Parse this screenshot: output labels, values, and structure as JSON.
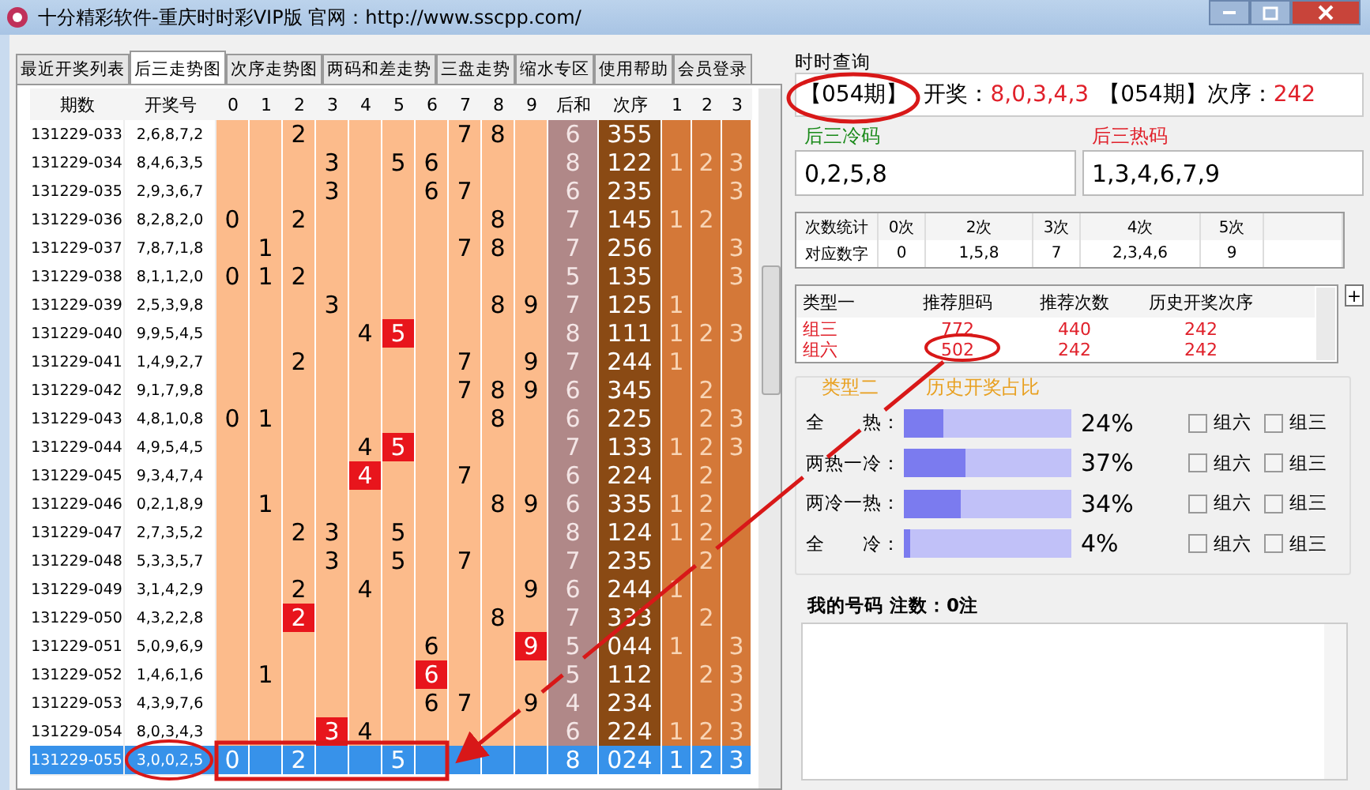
{
  "window": {
    "title": "十分精彩软件-重庆时时彩VIP版 官网：http://www.sscpp.com/"
  },
  "tabs": [
    {
      "label": "最近开奖列表",
      "selected": false
    },
    {
      "label": "后三走势图",
      "selected": true
    },
    {
      "label": "次序走势图",
      "selected": false
    },
    {
      "label": "两码和差走势",
      "selected": false
    },
    {
      "label": "三盘走势",
      "selected": false
    },
    {
      "label": "缩水专区",
      "selected": false
    },
    {
      "label": "使用帮助",
      "selected": false
    },
    {
      "label": "会员登录",
      "selected": false
    }
  ],
  "trend_table": {
    "columns": [
      "期数",
      "开奖号",
      "0",
      "1",
      "2",
      "3",
      "4",
      "5",
      "6",
      "7",
      "8",
      "9",
      "后和",
      "次序",
      "1",
      "2",
      "3"
    ],
    "rows": [
      {
        "period": "131229-033",
        "numbers": "2,6,8,7,2",
        "cells": {
          "d2": {
            "text": "2",
            "red": false
          },
          "d7": {
            "text": "7",
            "red": false
          },
          "d8": {
            "text": "8",
            "red": false
          }
        },
        "sum": "6",
        "order": "355",
        "flags": {},
        "selected": false
      },
      {
        "period": "131229-034",
        "numbers": "8,4,6,3,5",
        "cells": {
          "d3": {
            "text": "3",
            "red": false
          },
          "d5": {
            "text": "5",
            "red": false
          },
          "d6": {
            "text": "6",
            "red": false
          }
        },
        "sum": "8",
        "order": "122",
        "flags": {
          "f1": "1",
          "f2": "2",
          "f3": "3"
        },
        "selected": false
      },
      {
        "period": "131229-035",
        "numbers": "2,9,3,6,7",
        "cells": {
          "d3": {
            "text": "3",
            "red": false
          },
          "d6": {
            "text": "6",
            "red": false
          },
          "d7": {
            "text": "7",
            "red": false
          }
        },
        "sum": "6",
        "order": "235",
        "flags": {
          "f3": "3"
        },
        "selected": false
      },
      {
        "period": "131229-036",
        "numbers": "8,2,8,2,0",
        "cells": {
          "d0": {
            "text": "0",
            "red": false
          },
          "d2": {
            "text": "2",
            "red": false
          },
          "d8": {
            "text": "8",
            "red": false
          }
        },
        "sum": "7",
        "order": "145",
        "flags": {
          "f1": "1",
          "f2": "2"
        },
        "selected": false
      },
      {
        "period": "131229-037",
        "numbers": "7,8,7,1,8",
        "cells": {
          "d1": {
            "text": "1",
            "red": false
          },
          "d7": {
            "text": "7",
            "red": false
          },
          "d8": {
            "text": "8",
            "red": false
          }
        },
        "sum": "7",
        "order": "256",
        "flags": {
          "f3": "3"
        },
        "selected": false
      },
      {
        "period": "131229-038",
        "numbers": "8,1,1,2,0",
        "cells": {
          "d0": {
            "text": "0",
            "red": false
          },
          "d1": {
            "text": "1",
            "red": false
          },
          "d2": {
            "text": "2",
            "red": false
          }
        },
        "sum": "5",
        "order": "135",
        "flags": {
          "f3": "3"
        },
        "selected": false
      },
      {
        "period": "131229-039",
        "numbers": "2,5,3,9,8",
        "cells": {
          "d3": {
            "text": "3",
            "red": false
          },
          "d8": {
            "text": "8",
            "red": false
          },
          "d9": {
            "text": "9",
            "red": false
          }
        },
        "sum": "7",
        "order": "125",
        "flags": {
          "f1": "1"
        },
        "selected": false
      },
      {
        "period": "131229-040",
        "numbers": "9,9,5,4,5",
        "cells": {
          "d4": {
            "text": "4",
            "red": false
          },
          "d5": {
            "text": "5",
            "red": true
          }
        },
        "sum": "8",
        "order": "111",
        "flags": {
          "f1": "1",
          "f2": "2",
          "f3": "3"
        },
        "selected": false
      },
      {
        "period": "131229-041",
        "numbers": "1,4,9,2,7",
        "cells": {
          "d2": {
            "text": "2",
            "red": false
          },
          "d7": {
            "text": "7",
            "red": false
          },
          "d9": {
            "text": "9",
            "red": false
          }
        },
        "sum": "7",
        "order": "244",
        "flags": {
          "f1": "1"
        },
        "selected": false
      },
      {
        "period": "131229-042",
        "numbers": "9,1,7,9,8",
        "cells": {
          "d7": {
            "text": "7",
            "red": false
          },
          "d8": {
            "text": "8",
            "red": false
          },
          "d9": {
            "text": "9",
            "red": false
          }
        },
        "sum": "6",
        "order": "345",
        "flags": {
          "f2": "2"
        },
        "selected": false
      },
      {
        "period": "131229-043",
        "numbers": "4,8,1,0,8",
        "cells": {
          "d0": {
            "text": "0",
            "red": false
          },
          "d1": {
            "text": "1",
            "red": false
          },
          "d8": {
            "text": "8",
            "red": false
          }
        },
        "sum": "6",
        "order": "225",
        "flags": {
          "f2": "2",
          "f3": "3"
        },
        "selected": false
      },
      {
        "period": "131229-044",
        "numbers": "4,9,5,4,5",
        "cells": {
          "d4": {
            "text": "4",
            "red": false
          },
          "d5": {
            "text": "5",
            "red": true
          }
        },
        "sum": "7",
        "order": "133",
        "flags": {
          "f1": "1",
          "f2": "2",
          "f3": "3"
        },
        "selected": false
      },
      {
        "period": "131229-045",
        "numbers": "9,3,4,7,4",
        "cells": {
          "d4": {
            "text": "4",
            "red": true
          },
          "d7": {
            "text": "7",
            "red": false
          }
        },
        "sum": "6",
        "order": "224",
        "flags": {
          "f2": "2"
        },
        "selected": false
      },
      {
        "period": "131229-046",
        "numbers": "0,2,1,8,9",
        "cells": {
          "d1": {
            "text": "1",
            "red": false
          },
          "d8": {
            "text": "8",
            "red": false
          },
          "d9": {
            "text": "9",
            "red": false
          }
        },
        "sum": "6",
        "order": "335",
        "flags": {
          "f1": "1",
          "f2": "2"
        },
        "selected": false
      },
      {
        "period": "131229-047",
        "numbers": "2,7,3,5,2",
        "cells": {
          "d2": {
            "text": "2",
            "red": false
          },
          "d3": {
            "text": "3",
            "red": false
          },
          "d5": {
            "text": "5",
            "red": false
          }
        },
        "sum": "8",
        "order": "124",
        "flags": {
          "f1": "1",
          "f2": "2"
        },
        "selected": false
      },
      {
        "period": "131229-048",
        "numbers": "5,3,3,5,7",
        "cells": {
          "d3": {
            "text": "3",
            "red": false
          },
          "d5": {
            "text": "5",
            "red": false
          },
          "d7": {
            "text": "7",
            "red": false
          }
        },
        "sum": "7",
        "order": "235",
        "flags": {
          "f2": "2"
        },
        "selected": false
      },
      {
        "period": "131229-049",
        "numbers": "3,1,4,2,9",
        "cells": {
          "d2": {
            "text": "2",
            "red": false
          },
          "d4": {
            "text": "4",
            "red": false
          },
          "d9": {
            "text": "9",
            "red": false
          }
        },
        "sum": "6",
        "order": "244",
        "flags": {
          "f1": "1"
        },
        "selected": false
      },
      {
        "period": "131229-050",
        "numbers": "4,3,2,2,8",
        "cells": {
          "d2": {
            "text": "2",
            "red": true
          },
          "d8": {
            "text": "8",
            "red": false
          }
        },
        "sum": "7",
        "order": "333",
        "flags": {
          "f2": "2"
        },
        "selected": false
      },
      {
        "period": "131229-051",
        "numbers": "5,0,9,6,9",
        "cells": {
          "d6": {
            "text": "6",
            "red": false
          },
          "d9": {
            "text": "9",
            "red": true
          }
        },
        "sum": "5",
        "order": "044",
        "flags": {
          "f1": "1",
          "f3": "3"
        },
        "selected": false
      },
      {
        "period": "131229-052",
        "numbers": "1,4,6,1,6",
        "cells": {
          "d1": {
            "text": "1",
            "red": false
          },
          "d6": {
            "text": "6",
            "red": true
          }
        },
        "sum": "5",
        "order": "112",
        "flags": {
          "f2": "2",
          "f3": "3"
        },
        "selected": false
      },
      {
        "period": "131229-053",
        "numbers": "4,3,9,7,6",
        "cells": {
          "d6": {
            "text": "6",
            "red": false
          },
          "d7": {
            "text": "7",
            "red": false
          },
          "d9": {
            "text": "9",
            "red": false
          }
        },
        "sum": "4",
        "order": "234",
        "flags": {
          "f3": "3"
        },
        "selected": false
      },
      {
        "period": "131229-054",
        "numbers": "8,0,3,4,3",
        "cells": {
          "d3": {
            "text": "3",
            "red": true
          },
          "d4": {
            "text": "4",
            "red": false
          }
        },
        "sum": "6",
        "order": "224",
        "flags": {
          "f1": "1",
          "f2": "2",
          "f3": "3"
        },
        "selected": false
      },
      {
        "period": "131229-055",
        "numbers": "3,0,0,2,5",
        "cells": {
          "d0": {
            "text": "0",
            "red": false
          },
          "d2": {
            "text": "2",
            "red": false
          },
          "d5": {
            "text": "5",
            "red": false
          }
        },
        "sum": "8",
        "order": "024",
        "flags": {
          "f1": "1",
          "f2": "2",
          "f3": "3"
        },
        "selected": true
      }
    ]
  },
  "query": {
    "title": "时时查询",
    "issue": "【054期】",
    "draw_label": "开奖：",
    "draw_value": "8,0,3,4,3",
    "issue_2": "【054期】",
    "order_label": "次序：",
    "order_value": "242"
  },
  "cold": {
    "label": "后三冷码",
    "value": "0,2,5,8"
  },
  "hot": {
    "label": "后三热码",
    "value": "1,3,4,6,7,9"
  },
  "count_stats": {
    "rows": [
      [
        "次数统计",
        "0次",
        "2次",
        "3次",
        "4次",
        "5次"
      ],
      [
        "对应数字",
        "0",
        "1,5,8",
        "7",
        "2,3,4,6",
        "9"
      ]
    ]
  },
  "type_one": {
    "columns": [
      "类型一",
      "推荐胆码",
      "推荐次数",
      "历史开奖次序"
    ],
    "rows": [
      [
        "组三",
        "772",
        "440",
        "242"
      ],
      [
        "组六",
        "502",
        "242",
        "242"
      ]
    ],
    "expand_button": "+"
  },
  "type_two": {
    "legend": "类型二",
    "legend_2": "历史开奖占比",
    "rows": [
      {
        "label": "全　　热：",
        "level": 0.24,
        "percent": "24%",
        "options": [
          {
            "label": "组六",
            "checked": false
          },
          {
            "label": "组三",
            "checked": false
          }
        ]
      },
      {
        "label": "两热一冷：",
        "level": 0.37,
        "percent": "37%",
        "options": [
          {
            "label": "组六",
            "checked": false
          },
          {
            "label": "组三",
            "checked": false
          }
        ]
      },
      {
        "label": "两冷一热：",
        "level": 0.34,
        "percent": "34%",
        "options": [
          {
            "label": "组六",
            "checked": false
          },
          {
            "label": "组三",
            "checked": false
          }
        ]
      },
      {
        "label": "全　　冷：",
        "level": 0.04,
        "percent": "4%",
        "options": [
          {
            "label": "组六",
            "checked": false
          },
          {
            "label": "组三",
            "checked": false
          }
        ]
      }
    ]
  },
  "my_numbers": {
    "title": "我的号码 注数：0注"
  }
}
